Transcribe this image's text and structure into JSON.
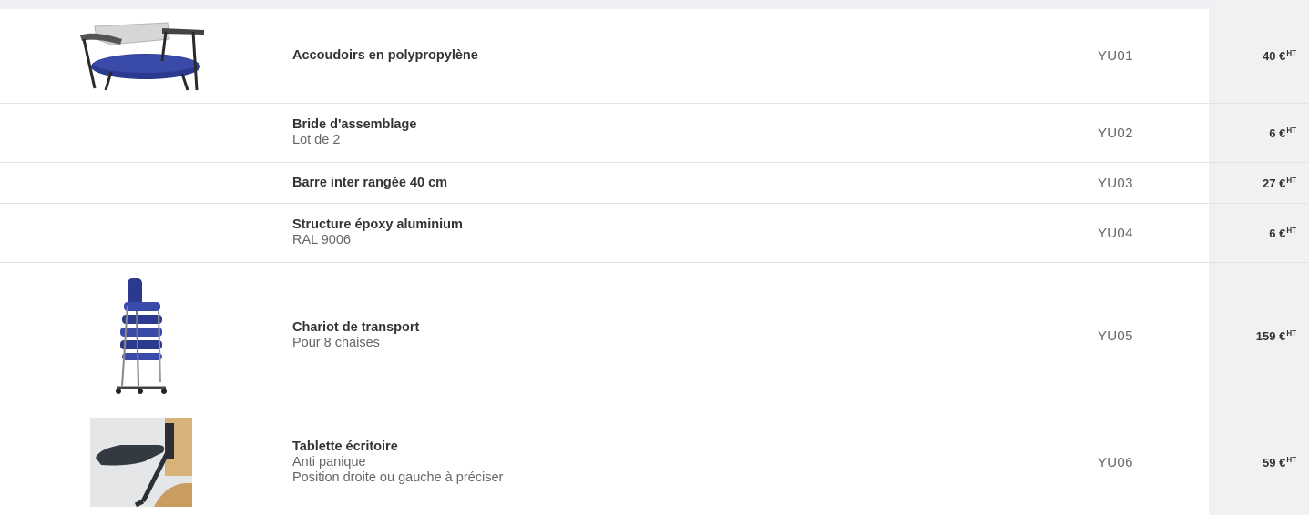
{
  "products": [
    {
      "name": "Accoudoirs en polypropylène",
      "details": [],
      "ref": "YU01",
      "price": "40 €",
      "price_suffix": "HT",
      "image": "chair-armrests-image"
    },
    {
      "name": "Bride d'assemblage",
      "details": [
        "Lot de 2"
      ],
      "ref": "YU02",
      "price": "6 €",
      "price_suffix": "HT",
      "image": null
    },
    {
      "name": "Barre inter rangée 40 cm",
      "details": [],
      "ref": "YU03",
      "price": "27 €",
      "price_suffix": "HT",
      "image": null
    },
    {
      "name": "Structure époxy aluminium",
      "details": [
        "RAL 9006"
      ],
      "ref": "YU04",
      "price": "6 €",
      "price_suffix": "HT",
      "image": null
    },
    {
      "name": "Chariot de transport",
      "details": [
        "Pour 8 chaises"
      ],
      "ref": "YU05",
      "price": "159 €",
      "price_suffix": "HT",
      "image": "chair-cart-image"
    },
    {
      "name": "Tablette écritoire",
      "details": [
        "Anti panique",
        "Position droite ou gauche à préciser"
      ],
      "ref": "YU06",
      "price": "59 €",
      "price_suffix": "HT",
      "image": "writing-tablet-image"
    }
  ],
  "colors": {
    "chair_blue": "#2b3a8f",
    "frame_dark": "#2a2a2a",
    "price_column_bg": "#f1f1f1",
    "divider": "#e3e3e3"
  }
}
